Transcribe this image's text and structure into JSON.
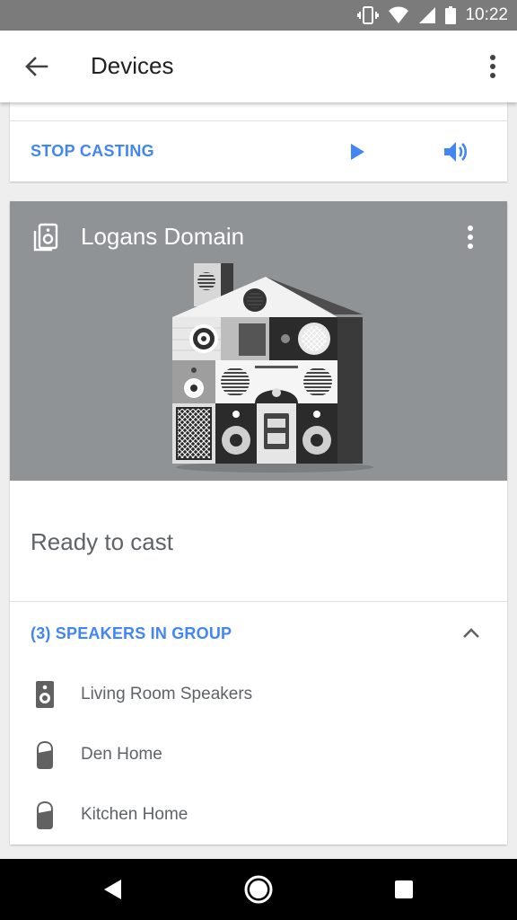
{
  "status_bar": {
    "time": "10:22"
  },
  "app_bar": {
    "title": "Devices"
  },
  "casting_card": {
    "stop_label": "STOP CASTING"
  },
  "device": {
    "name": "Logans Domain",
    "status": "Ready to cast",
    "group_header": "(3) SPEAKERS IN GROUP",
    "speakers": [
      {
        "label": "Living Room Speakers",
        "icon": "speaker-icon"
      },
      {
        "label": "Den Home",
        "icon": "google-home-icon"
      },
      {
        "label": "Kitchen Home",
        "icon": "google-home-icon"
      }
    ]
  },
  "colors": {
    "accent": "#4285f4",
    "hero_bg": "#8f9396"
  }
}
